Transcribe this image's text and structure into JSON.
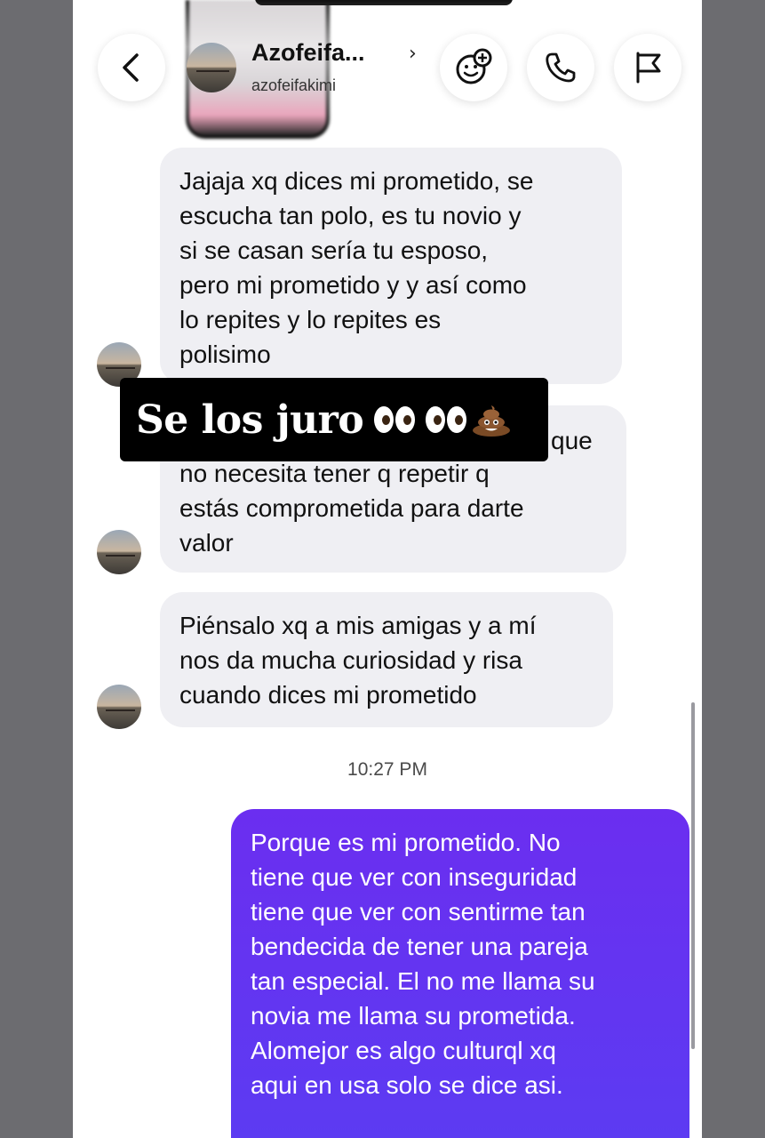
{
  "header": {
    "name": "Azofeifa...",
    "username": "azofeifakimi",
    "chevron": "›"
  },
  "icons": {
    "back": "back-chevron-icon",
    "effects": "sticker-effects-icon",
    "call": "phone-icon",
    "report": "flag-icon"
  },
  "messages": [
    {
      "direction": "in",
      "text": "Jajaja xq dices mi prometido, se\nescucha tan polo, es tu novio y\nsi se casan sería tu esposo,\npero mi prometido y y así como\nlo repites y lo repites es\npolisimo"
    },
    {
      "direction": "in",
      "text": "que\nno necesita tener q repetir q\nestás comprometida para darte\nvalor"
    },
    {
      "direction": "in",
      "text": "Piénsalo xq a mis amigas y a mí\nnos da mucha curiosidad y risa\ncuando dices mi prometido"
    },
    {
      "direction": "out",
      "text": "Porque es mi prometido. No\ntiene que ver con inseguridad\ntiene que ver con sentirme tan\nbendecida de tener una pareja\ntan especial. El no me llama su\nnovia me llama su prometida.\nAlomejor es algo culturql xq\naqui en usa solo se dice asi."
    }
  ],
  "timestamp": "10:27 PM",
  "overlay": {
    "text": "Se los juro",
    "emoji": [
      "eyes-emoji",
      "eyes-emoji",
      "poop-emoji"
    ]
  },
  "colors": {
    "incoming_bubble": "#efeff3",
    "outgoing_bubble_top": "#6b2ef0",
    "outgoing_bubble_bottom": "#5b3cf2",
    "side_bars": "#6c6c70"
  }
}
